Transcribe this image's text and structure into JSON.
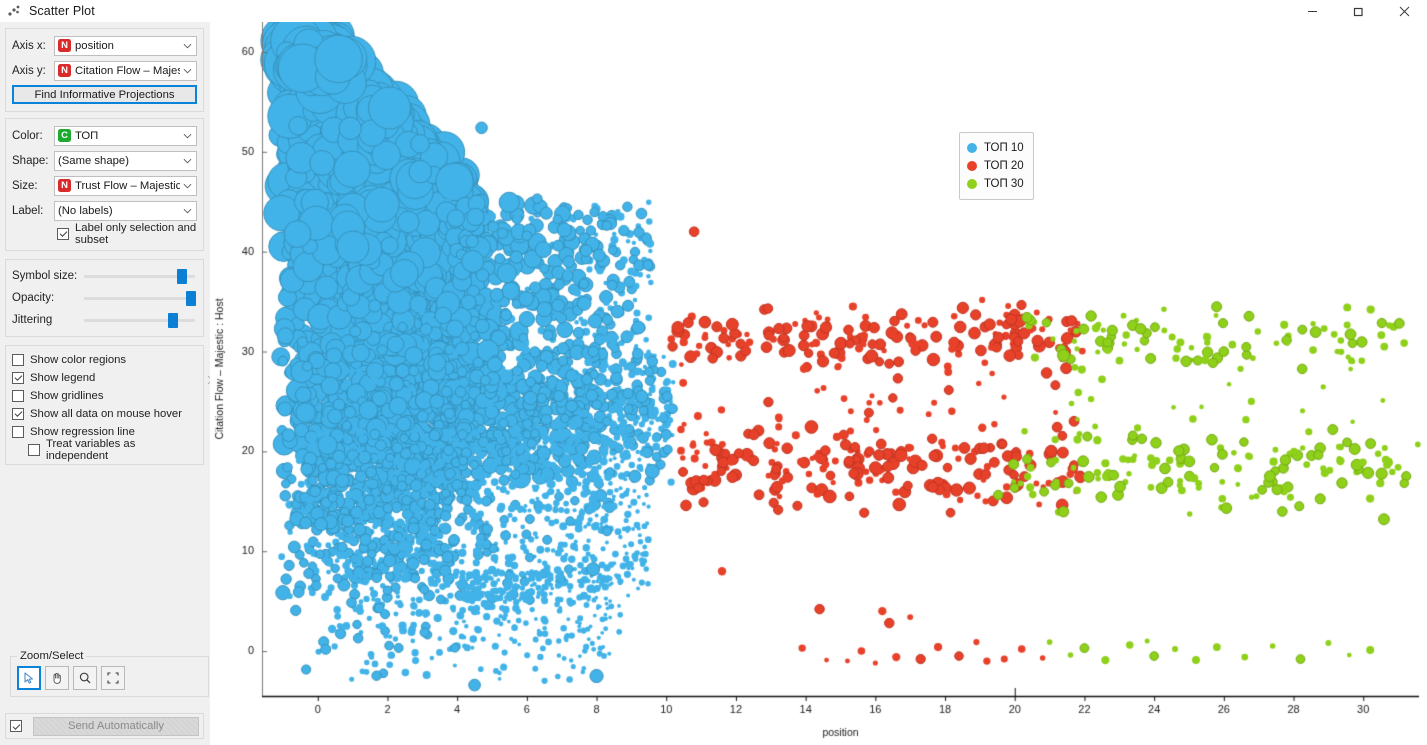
{
  "window": {
    "title": "Scatter Plot",
    "icon": "scatter-plot-icon",
    "minimize_label": "–",
    "maximize_label": "❐",
    "close_label": "✕"
  },
  "sidebar": {
    "axis_group": {
      "axis_x_label": "Axis x:",
      "axis_x_value": "position",
      "axis_x_vartype": "N",
      "axis_y_label": "Axis y:",
      "axis_y_value": "Citation Flow  –  Majestic",
      "axis_y_vartype": "N",
      "find_projections_label": "Find Informative Projections"
    },
    "attrs_group": {
      "color_label": "Color:",
      "color_value": "ТОП",
      "color_vartype": "C",
      "shape_label": "Shape:",
      "shape_value": "(Same shape)",
      "size_label": "Size:",
      "size_value": "Trust Flow  –  Majestic :  |",
      "size_vartype": "N",
      "label_label": "Label:",
      "label_value": "(No labels)",
      "label_only_selection": "Label only selection and subset",
      "label_only_selection_checked": true
    },
    "sliders": [
      {
        "label": "Symbol size:",
        "value": 88
      },
      {
        "label": "Opacity:",
        "value": 96
      },
      {
        "label": "Jittering",
        "value": 80
      }
    ],
    "options": [
      {
        "label": "Show color regions",
        "checked": false,
        "indent": 0
      },
      {
        "label": "Show legend",
        "checked": true,
        "indent": 0
      },
      {
        "label": "Show gridlines",
        "checked": false,
        "indent": 0
      },
      {
        "label": "Show all data on mouse hover",
        "checked": true,
        "indent": 0
      },
      {
        "label": "Show regression line",
        "checked": false,
        "indent": 0
      },
      {
        "label": "Treat variables as independent",
        "checked": false,
        "indent": 1
      }
    ],
    "zoom_select": {
      "title": "Zoom/Select",
      "buttons": [
        {
          "name": "select-arrow",
          "active": true,
          "disabled": false
        },
        {
          "name": "pan-hand",
          "active": false,
          "disabled": false
        },
        {
          "name": "zoom-magnifier",
          "active": false,
          "disabled": false
        },
        {
          "name": "reset-zoom",
          "active": false,
          "disabled": false
        }
      ]
    },
    "send": {
      "auto_checked": true,
      "button_label": "Send Automatically"
    }
  },
  "chart_data": {
    "type": "scatter",
    "title": "",
    "xlabel": "position",
    "ylabel": "Citation Flow – Majestic : Host",
    "xlim": [
      -1.6,
      31.6
    ],
    "ylim": [
      -4.5,
      63.0
    ],
    "xticks": [
      0,
      2,
      4,
      6,
      8,
      10,
      12,
      14,
      16,
      18,
      20,
      22,
      24,
      26,
      28,
      30
    ],
    "yticks": [
      0,
      10,
      20,
      30,
      40,
      50,
      60
    ],
    "grid": false,
    "legend_position": "top-right",
    "size_encoding": "Trust Flow – Majestic : Host",
    "series": [
      {
        "name": "ТОП 10",
        "color": "#42b3e8",
        "n_points": 4200,
        "x_range": [
          -1.2,
          10.2
        ],
        "y_range": [
          -4.0,
          61.0
        ],
        "description": "Dense large-bubble cloud hugging the left edge; tapers from y=61 down to y=-4 with a heavy core between x=-1 and x=4 and a thinning tail to x=10"
      },
      {
        "name": "ТОП 20",
        "color": "#e8412a",
        "n_points": 430,
        "x_range": [
          10.2,
          22.0
        ],
        "y_range": [
          -2.0,
          42.0
        ],
        "description": "Two horizontal bands near y=31 and y=18 spanning x=10 to x=22, plus sparse outliers near y=0 and a single point at y=42"
      },
      {
        "name": "ТОП 30",
        "color": "#8fd01a",
        "n_points": 260,
        "x_range": [
          19.5,
          31.2
        ],
        "y_range": [
          -1.5,
          34.0
        ],
        "description": "Bands near y=31 and y=18 spanning x=20 to x=31, plus a sparse low row near y=0"
      }
    ],
    "legend": [
      {
        "label": "ТОП 10",
        "color": "#42b3e8"
      },
      {
        "label": "ТОП 20",
        "color": "#e8412a"
      },
      {
        "label": "ТОП 30",
        "color": "#8fd01a"
      }
    ]
  }
}
